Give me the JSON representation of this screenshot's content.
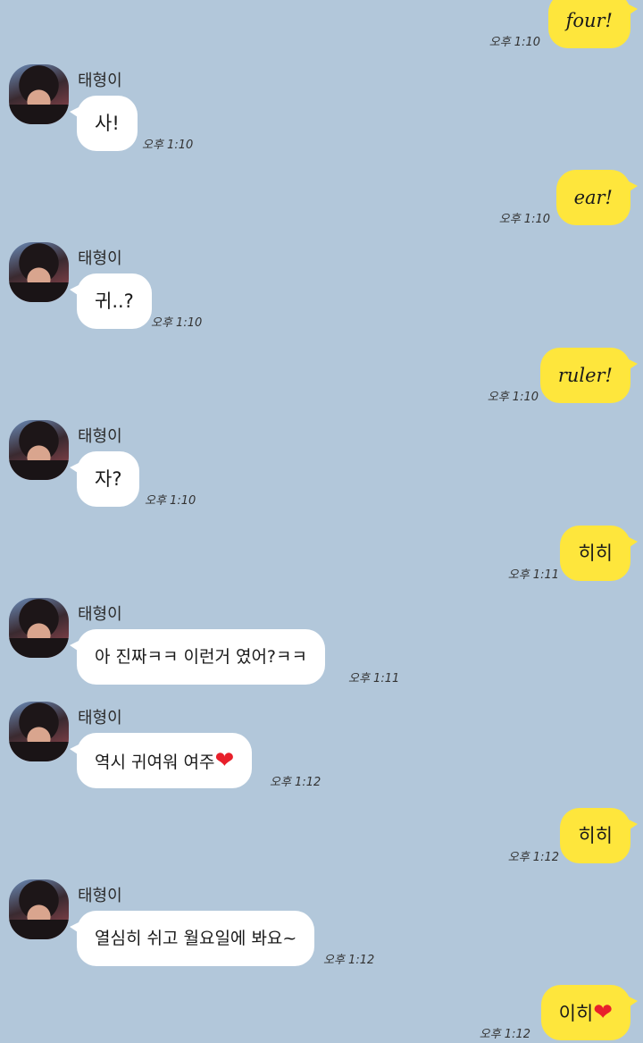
{
  "chat": {
    "messages": [
      {
        "from": "me",
        "text": "four!",
        "time": "오후 1:10"
      },
      {
        "from": "other",
        "sender": "태형이",
        "text": "사!",
        "time": "오후 1:10"
      },
      {
        "from": "me",
        "text": "ear!",
        "time": "오후 1:10"
      },
      {
        "from": "other",
        "sender": "태형이",
        "text": "귀..?",
        "time": "오후 1:10"
      },
      {
        "from": "me",
        "text": "ruler!",
        "time": "오후 1:10"
      },
      {
        "from": "other",
        "sender": "태형이",
        "text": "자?",
        "time": "오후 1:10"
      },
      {
        "from": "me",
        "text": "히히",
        "time": "오후 1:11"
      },
      {
        "from": "other",
        "sender": "태형이",
        "text": "아 진짜ㅋㅋ 이런거 였어?ㅋㅋ",
        "time": "오후 1:11"
      },
      {
        "from": "other",
        "sender": "태형이",
        "text": "역시 귀여워 여주",
        "emoji": "❤",
        "time": "오후 1:12"
      },
      {
        "from": "me",
        "text": "히히",
        "time": "오후 1:12"
      },
      {
        "from": "other",
        "sender": "태형이",
        "text": "열심히 쉬고 월요일에 봐요~",
        "time": "오후 1:12"
      },
      {
        "from": "me",
        "text": "이히",
        "emoji": "❤",
        "time": "오후 1:12"
      }
    ]
  }
}
